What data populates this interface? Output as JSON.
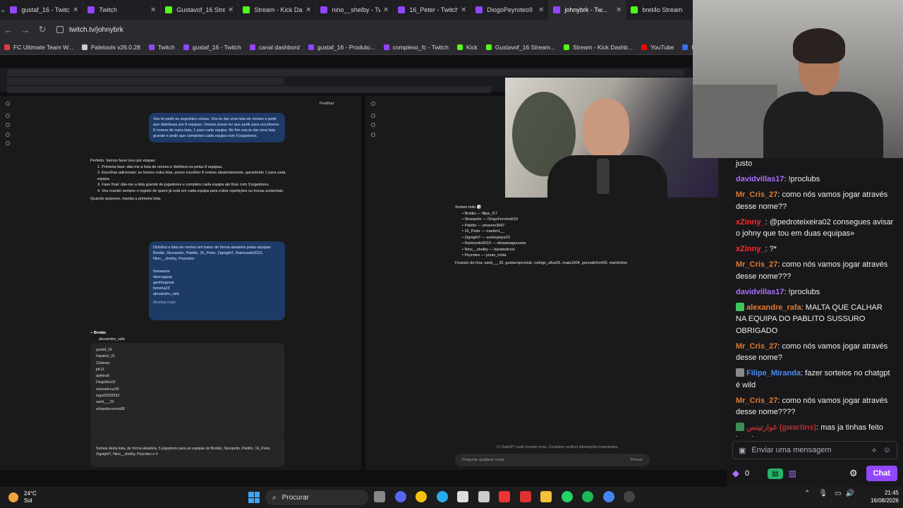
{
  "browser": {
    "tabs": [
      {
        "title": "gustaf_16 - Twitch",
        "icon": "twitch"
      },
      {
        "title": "Twitch",
        "icon": "twitch"
      },
      {
        "title": "Gustavof_16 Strea...",
        "icon": "kick"
      },
      {
        "title": "Stream - Kick Das...",
        "icon": "kick"
      },
      {
        "title": "nino__shelby - Tw...",
        "icon": "twitch"
      },
      {
        "title": "16_Peter - Twitch",
        "icon": "twitch"
      },
      {
        "title": "DiogoPeyroteo9",
        "icon": "twitch"
      },
      {
        "title": "johnybrk - Tw...",
        "icon": "twitch",
        "active": true
      },
      {
        "title": "bret4o Stream",
        "icon": "kick"
      }
    ],
    "url": "twitch.tv/johnybrk",
    "bookmarks": [
      {
        "label": "FC Ultimate Team W...",
        "icon": "fc"
      },
      {
        "label": "Paletools v26.0.28",
        "icon": "grey"
      },
      {
        "label": "Twitch",
        "icon": "twitch"
      },
      {
        "label": "gustaf_16 - Twitch",
        "icon": "twitch"
      },
      {
        "label": "canal dashbord",
        "icon": "twitch"
      },
      {
        "label": "gustaf_16 - Produto...",
        "icon": "twitch"
      },
      {
        "label": "complexo_fc - Twitch",
        "icon": "twitch"
      },
      {
        "label": "Kick",
        "icon": "kick"
      },
      {
        "label": "Gustavof_16 Stream...",
        "icon": "kick"
      },
      {
        "label": "Stream - Kick Dashb...",
        "icon": "kick"
      },
      {
        "label": "YouTube",
        "icon": "red"
      },
      {
        "label": "Painel - Bah...",
        "icon": "blue"
      }
    ]
  },
  "stream": {
    "left_user_msg": "Vou-te pedir as seguintes coisas. Vou-te dar uma lista de nomes e pedir que distribuas por 8 equipas. Depois posso ter que pedir para escolheres 8 nomes de outra lista, 1 para cada equipa. No fim vou-te dar uma lista grande e pedir que completes cada equipa com 9 jogadores.",
    "left_answer_intro": "Perfeito. Vamos fazer isso por etapas:",
    "left_answer_steps": [
      "Primeira fase: dás-me a lista de nomes e distribuo-os pelas 8 equipas.",
      "Escolhas adicionais: se tiveres outra lista, posso escolher 8 nomes aleatoriamente, garantindo 1 para cada equipa.",
      "Fase final: dás-me a lista grande de jogadores e completo cada equipa até ficar com 9 jogadores.",
      "Vou manter sempre o registo de quem já está em cada equipa para evitar repetições ou trocas acidentais."
    ],
    "left_answer_outro": "Quando quiseres, manda a primeira lista.",
    "left_user_msg2": "Distribui a lista de nomes em baixo de forma aleatória pelas equipas Bretão, Skoopelio, Pablito, 16_Peter, Zignight7, Raimundo0010, Nino__shelby, Peyroteo.",
    "left_user_list": [
      "Noneame",
      "dannygasp",
      "gonthegreat",
      "ferreira23",
      "alexandre_rafa"
    ],
    "left_show_more": "Mostrar mais",
    "left_team_label": "Bretão",
    "left_team_first": "alexandre_rafa",
    "left_code_lines": [
      "gustaf_16",
      "hayatoo_21",
      "13almaz",
      "jdr13",
      "apfeira8",
      "Diogo9ec02",
      "manuelcruz95",
      "tuga33333333",
      "santi___32",
      "eduardocorreia98"
    ],
    "left_composer_text": "Sorteia desta lista, de forma aleatória, 5 jogadores para as equipas do Bretão, Skoopelio, Pablito, 16_Peter, Zignight7, Nino__shelby, Peyroteo e 4",
    "left_composer_hint": "Pensar",
    "right_title": "Sorteio feito 🎲",
    "right_draw": [
      "Bretão — filipe_f17",
      "Skoopelio — DiogoFerreira919",
      "Pablito — phoenix3687",
      "16_Peter — martim1__",
      "Zignight7 — andreplays23",
      "Raimundo0010 — silvaamagouveia",
      "Nino__shelby — baratosfcxxi",
      "Peyroteo — jonas_mota"
    ],
    "right_left_out": "Ficaram de fora: santi___32, gustavoproclub, rodrigo_silva26, mata1904, goncalinho430, martimdss",
    "right_disclaimer": "O ChatGPT pode cometer erros. Considere verificar informações importantes.",
    "right_composer": "Pergunte qualquer coisa",
    "right_composer_hint": "Pensar",
    "share_label": "Partilhar"
  },
  "chat": {
    "messages": [
      {
        "user": "",
        "color": "#efeff1",
        "text": "justo"
      },
      {
        "user": "davidvillas17",
        "color": "#a970ff",
        "text": ": !proclubs"
      },
      {
        "user": "Mr_Cris_27",
        "color": "#e37a2c",
        "text": ": como nós vamos jogar através desse nome??"
      },
      {
        "user": "xZinny_",
        "color": "#ff2b2b",
        "text": ": @pedroteixeira02 consegues avisar o johny que tou em duas equipas»"
      },
      {
        "user": "xZinny_",
        "color": "#ff2b2b",
        "text": ": ?*"
      },
      {
        "user": "Mr_Cris_27",
        "color": "#e37a2c",
        "text": ": como nós vamos jogar através desse nome???"
      },
      {
        "user": "davidvillas17",
        "color": "#a970ff",
        "text": ": !proclubs"
      },
      {
        "user": "alexandre_rafa",
        "color": "#e37a2c",
        "text": ": MALTA QUE CALHAR NA EQUIPA DO PABLITO SUSSURO OBRIGADO",
        "badge": "#3ec45b"
      },
      {
        "user": "Mr_Cris_27",
        "color": "#e37a2c",
        "text": ": como nós vamos jogar através desse nome?"
      },
      {
        "user": "Filipe_Miranda",
        "color": "#4f8cf0",
        "text": ": fazer sorteios no chatgpt é wild",
        "badge": "#8a8a8a"
      },
      {
        "user": "Mr_Cris_27",
        "color": "#e37a2c",
        "text": ": como nós vamos jogar através desse nome????"
      },
      {
        "user": "غوارتينس (gwartins)",
        "color": "#b33030",
        "text": ": mas ja tinhas feito isso irmao",
        "badge": "#3e8e55"
      }
    ],
    "input_placeholder": "Enviar uma mensagem",
    "points": "0",
    "chat_button": "Chat"
  },
  "taskbar": {
    "temp": "24°C",
    "weather": "Sol",
    "search": "Procurar",
    "time": "21:45",
    "date": "16/08/2026"
  }
}
